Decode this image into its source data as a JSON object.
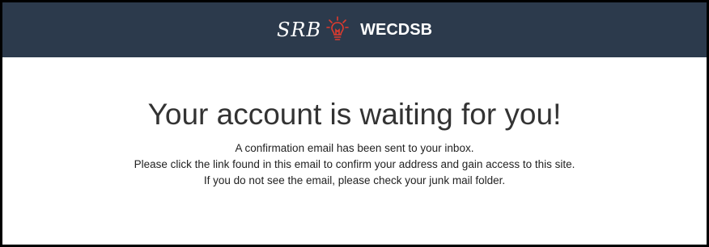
{
  "header": {
    "logo_text": "SRB",
    "logo_icon": "lightbulb-icon",
    "org_name": "WECDSB",
    "colors": {
      "background": "#2c3a4c",
      "logo_accent": "#e03b2e"
    }
  },
  "main": {
    "title": "Your account is waiting for you!",
    "lines": [
      "A confirmation email has been sent to your inbox.",
      "Please click the link found in this email to confirm your address and gain access to this site.",
      "If you do not see the email, please check your junk mail folder."
    ]
  }
}
